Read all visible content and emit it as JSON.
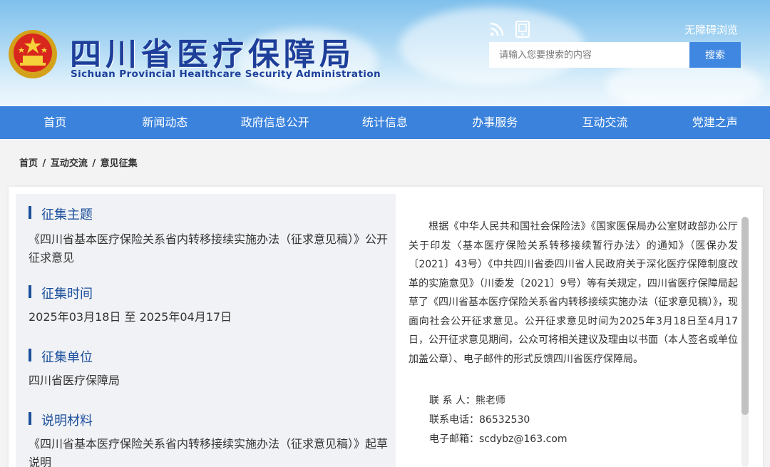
{
  "header": {
    "logo_cn": "四川省医疗保障局",
    "logo_en": "Sichuan Provincial Healthcare Security Administration",
    "accessible_label": "无障碍浏览",
    "search_placeholder": "请输入您要搜索的内容",
    "search_button": "搜索"
  },
  "nav": {
    "items": [
      "首页",
      "新闻动态",
      "政府信息公开",
      "统计信息",
      "办事服务",
      "互动交流",
      "党建之声"
    ]
  },
  "breadcrumb": {
    "items": [
      "首页",
      "互动交流",
      "意见征集"
    ],
    "separator": "/"
  },
  "sections": [
    {
      "title": "征集主题",
      "text": "《四川省基本医疗保险关系省内转移接续实施办法（征求意见稿）》公开征求意见"
    },
    {
      "title": "征集时间",
      "text": "2025年03月18日 至 2025年04月17日"
    },
    {
      "title": "征集单位",
      "text": "四川省医疗保障局"
    },
    {
      "title": "说明材料",
      "text": "《四川省基本医疗保险关系省内转移接续实施办法（征求意见稿）》起草说明"
    }
  ],
  "body_text": "根据《中华人民共和国社会保险法》《国家医保局办公室财政部办公厅关于印发〈基本医疗保险关系转移接续暂行办法〉的通知》（医保办发〔2021〕43号）《中共四川省委四川省人民政府关于深化医疗保障制度改革的实施意见》（川委发〔2021〕9号）等有关规定，四川省医疗保障局起草了《四川省基本医疗保险关系省内转移接续实施办法（征求意见稿）》，现面向社会公开征求意见。公开征求意见时间为2025年3月18日至4月17日，公开征求意见期间，公众可将相关建议及理由以书面（本人签名或单位加盖公章）、电子邮件的形式反馈四川省医疗保障局。",
  "contact": {
    "person": "联 系 人：熊老师",
    "phone": "联系电话：86532530",
    "email": "电子邮箱：scdybz@163.com"
  },
  "colors": {
    "nav_bg": "#3a82dc",
    "title_blue": "#1b4f9c",
    "search_button_bg": "#3f87e0"
  }
}
